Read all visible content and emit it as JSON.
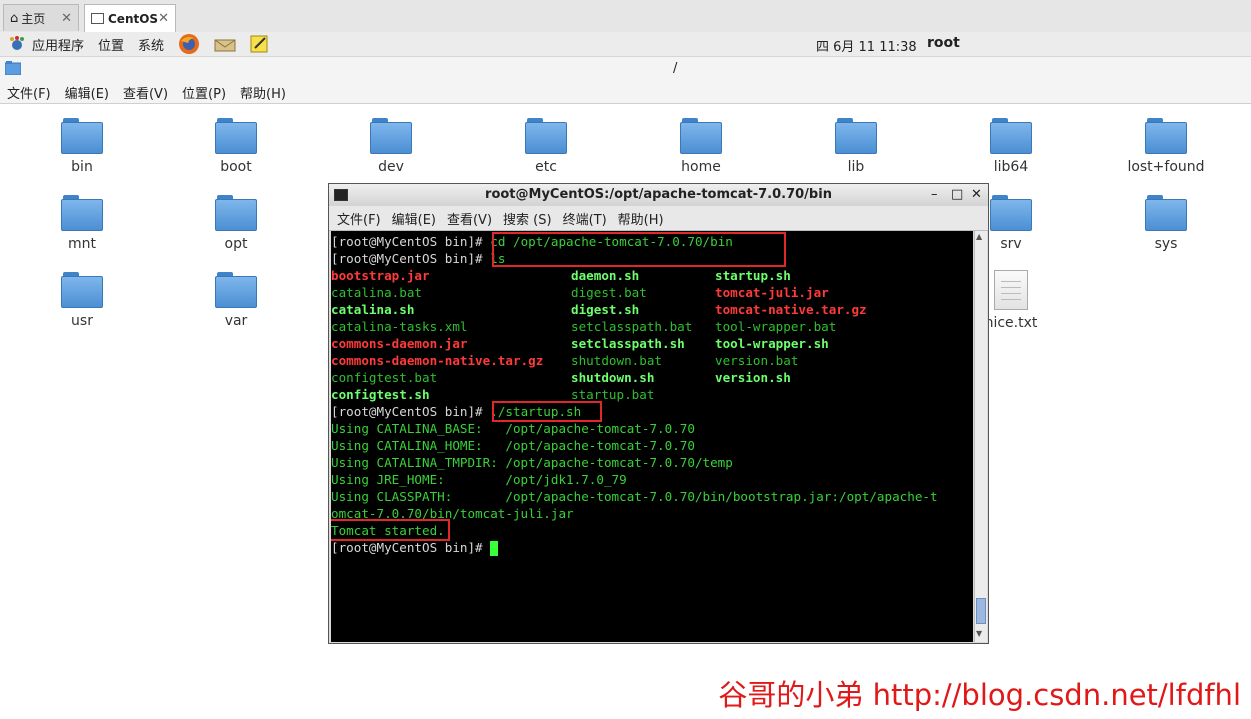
{
  "browser_tabs": [
    {
      "label": "主页",
      "icon": "home-icon"
    },
    {
      "label": "CentOS",
      "icon": "vm-icon",
      "active": true
    }
  ],
  "panel": {
    "menus": [
      "应用程序",
      "位置",
      "系统"
    ],
    "clock": "四 6月 11 11:38",
    "user": "root"
  },
  "file_manager": {
    "path": "/",
    "menu": [
      "文件(F)",
      "编辑(E)",
      "查看(V)",
      "位置(P)",
      "帮助(H)"
    ],
    "items": [
      {
        "name": "bin"
      },
      {
        "name": "boot"
      },
      {
        "name": "dev"
      },
      {
        "name": "etc"
      },
      {
        "name": "home"
      },
      {
        "name": "lib"
      },
      {
        "name": "lib64"
      },
      {
        "name": "lost+found"
      },
      {
        "name": "mnt"
      },
      {
        "name": "opt"
      },
      {
        "name": "srv"
      },
      {
        "name": "sys"
      },
      {
        "name": "usr"
      },
      {
        "name": "var"
      },
      {
        "name": "nice.txt"
      }
    ]
  },
  "terminal": {
    "title": "root@MyCentOS:/opt/apache-tomcat-7.0.70/bin",
    "menu": [
      "文件(F)",
      "编辑(E)",
      "查看(V)",
      "搜索 (S)",
      "终端(T)",
      "帮助(H)"
    ],
    "prompt": "[root@MyCentOS bin]# ",
    "cmd1": "cd /opt/apache-tomcat-7.0.70/bin",
    "cmd2": "ls",
    "ls_col1": [
      "bootstrap.jar",
      "catalina.bat",
      "catalina.sh",
      "catalina-tasks.xml",
      "commons-daemon.jar",
      "commons-daemon-native.tar.gz",
      "configtest.bat",
      "configtest.sh"
    ],
    "ls_col2": [
      "daemon.sh",
      "digest.bat",
      "digest.sh",
      "setclasspath.bat",
      "setclasspath.sh",
      "shutdown.bat",
      "shutdown.sh",
      "startup.bat"
    ],
    "ls_col3": [
      "startup.sh",
      "tomcat-juli.jar",
      "tomcat-native.tar.gz",
      "tool-wrapper.bat",
      "tool-wrapper.sh",
      "version.bat",
      "version.sh"
    ],
    "cmd3": "./startup.sh",
    "out": [
      "Using CATALINA_BASE:   /opt/apache-tomcat-7.0.70",
      "Using CATALINA_HOME:   /opt/apache-tomcat-7.0.70",
      "Using CATALINA_TMPDIR: /opt/apache-tomcat-7.0.70/temp",
      "Using JRE_HOME:        /opt/jdk1.7.0_79",
      "Using CLASSPATH:       /opt/apache-tomcat-7.0.70/bin/bootstrap.jar:/opt/apache-t",
      "omcat-7.0.70/bin/tomcat-juli.jar"
    ],
    "started": "Tomcat started.",
    "last_prompt": "[root@MyCentOS bin]# "
  },
  "watermark": "谷哥的小弟 http://blog.csdn.net/lfdfhl"
}
